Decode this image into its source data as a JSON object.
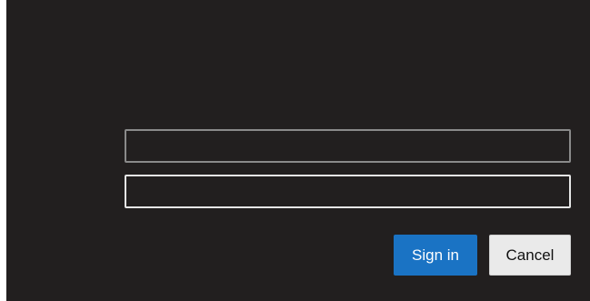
{
  "form": {
    "username": {
      "value": "",
      "placeholder": ""
    },
    "password": {
      "value": "",
      "placeholder": ""
    }
  },
  "buttons": {
    "sign_in_label": "Sign in",
    "cancel_label": "Cancel"
  },
  "colors": {
    "background": "#221f1f",
    "accent": "#1a73c4",
    "cancel_background": "#eaeaea"
  }
}
